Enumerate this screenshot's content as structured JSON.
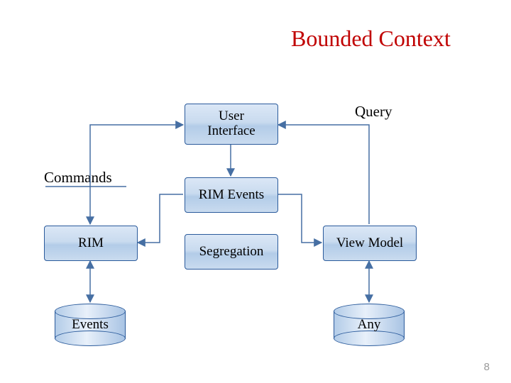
{
  "title": "Bounded Context",
  "labels": {
    "query": "Query",
    "commands": "Commands"
  },
  "boxes": {
    "user_interface": "User\nInterface",
    "rim_events": "RIM Events",
    "rim": "RIM",
    "segregation": "Segregation",
    "view_model": "View Model"
  },
  "cylinders": {
    "events": "Events",
    "any": "Any"
  },
  "page_number": "8"
}
